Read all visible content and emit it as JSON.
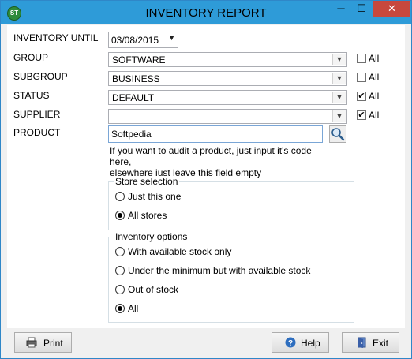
{
  "window": {
    "title": "INVENTORY REPORT",
    "app_icon_text": "ST"
  },
  "titlebar_buttons": {
    "minimize": "─",
    "maximize": "☐",
    "close": "✕"
  },
  "form": {
    "inventory_until": {
      "label": "INVENTORY UNTIL",
      "value": "03/08/2015"
    },
    "group": {
      "label": "GROUP",
      "value": "SOFTWARE",
      "all_label": "All",
      "all_checked": false
    },
    "subgroup": {
      "label": "SUBGROUP",
      "value": "BUSINESS",
      "all_label": "All",
      "all_checked": false
    },
    "status": {
      "label": "STATUS",
      "value": "DEFAULT",
      "all_label": "All",
      "all_checked": true
    },
    "supplier": {
      "label": "SUPPLIER",
      "value": "",
      "all_label": "All",
      "all_checked": true
    },
    "product": {
      "label": "PRODUCT",
      "value": "Softpedia"
    },
    "hint_line1": "If you want to audit a product, just input it's code here,",
    "hint_line2": "elsewhere just leave this field empty"
  },
  "store_selection": {
    "title": "Store selection",
    "options": [
      {
        "label": "Just this one",
        "selected": false
      },
      {
        "label": "All stores",
        "selected": true
      }
    ]
  },
  "inventory_options": {
    "title": "Inventory options",
    "options": [
      {
        "label": "With available stock only",
        "selected": false
      },
      {
        "label": "Under the minimum but with available stock",
        "selected": false
      },
      {
        "label": "Out of stock",
        "selected": false
      },
      {
        "label": "All",
        "selected": true
      }
    ]
  },
  "footer": {
    "print_label": "Print",
    "help_label": "Help",
    "exit_label": "Exit"
  },
  "icons": [
    "app-icon",
    "minimize-icon",
    "maximize-icon",
    "close-icon",
    "dropdown-arrow-icon",
    "search-icon",
    "printer-icon",
    "help-icon",
    "exit-door-icon"
  ]
}
